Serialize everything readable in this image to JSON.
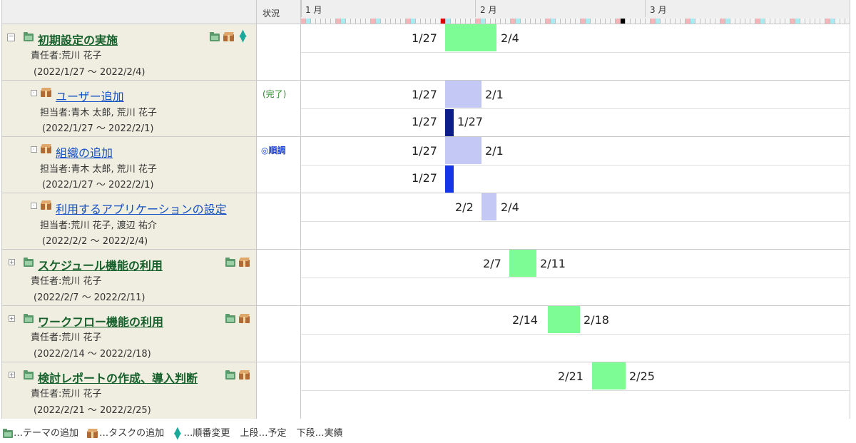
{
  "header": {
    "status_label": "状況",
    "months": [
      "1 月",
      "2 月",
      "3 月"
    ]
  },
  "rows": [
    {
      "type": "theme",
      "title": "初期設定の実施",
      "person": "責任者:荒川 花子",
      "period": "(2022/1/27 〜 2022/2/4)",
      "status": "",
      "plan": {
        "start_label": "1/27",
        "end_label": "2/4"
      },
      "toggle": "－"
    },
    {
      "type": "task",
      "title": "ユーザー追加",
      "person": "担当者:青木 太郎, 荒川 花子",
      "period": "(2022/1/27 〜 2022/2/1)",
      "status": "(完了)",
      "plan": {
        "start_label": "1/27",
        "end_label": "2/1"
      },
      "actual": {
        "start_label": "1/27",
        "end_label": "1/27"
      }
    },
    {
      "type": "task",
      "title": "組織の追加",
      "person": "担当者:青木 太郎, 荒川 花子",
      "period": "(2022/1/27 〜 2022/2/1)",
      "status": "◎順調",
      "plan": {
        "start_label": "1/27",
        "end_label": "2/1"
      },
      "actual": {
        "start_label": "1/27"
      }
    },
    {
      "type": "task",
      "title": "利用するアプリケーションの設定",
      "person": "担当者:荒川 花子, 渡辺 祐介",
      "period": "(2022/2/2 〜 2022/2/4)",
      "status": "",
      "plan": {
        "start_label": "2/2",
        "end_label": "2/4"
      }
    },
    {
      "type": "theme",
      "title": "スケジュール機能の利用",
      "person": "責任者:荒川 花子",
      "period": "(2022/2/7 〜 2022/2/11)",
      "status": "",
      "plan": {
        "start_label": "2/7",
        "end_label": "2/11"
      },
      "toggle": "+"
    },
    {
      "type": "theme",
      "title": "ワークフロー機能の利用",
      "person": "責任者:荒川 花子",
      "period": "(2022/2/14 〜 2022/2/18)",
      "status": "",
      "plan": {
        "start_label": "2/14",
        "end_label": "2/18"
      },
      "toggle": "+"
    },
    {
      "type": "theme",
      "title": "検討レポートの作成、導入判断",
      "person": "責任者:荒川 花子",
      "period": "(2022/2/21 〜 2022/2/25)",
      "status": "",
      "plan": {
        "start_label": "2/21",
        "end_label": "2/25"
      },
      "toggle": "+"
    }
  ],
  "legend": {
    "theme_add": "…テーマの追加",
    "task_add": "…タスクの追加",
    "reorder": "…順番変更",
    "upper": "上段…予定",
    "lower": "下段…実績"
  },
  "colors": {
    "theme_bar": "#7dfc96",
    "task_plan_bar": "#c4c8f5",
    "actual_done_bar": "#0d1e8a",
    "actual_progress_bar": "#1634e8",
    "today_marker": "#e60000"
  }
}
